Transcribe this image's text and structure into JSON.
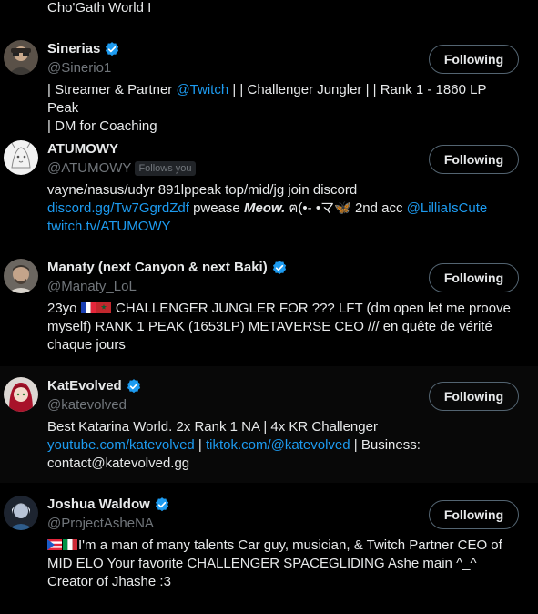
{
  "top_bio_tail": "Cho'Gath World I",
  "follow_button_label": "Following",
  "users": [
    {
      "display_name": "Sinerias",
      "verified": true,
      "handle": "@Sinerio1",
      "bio_line1_a": "| Streamer & Partner ",
      "bio_line1_link": "@Twitch",
      "bio_line1_b": " | | Challenger Jungler | | Rank 1 - 1860 LP Peak",
      "bio_line2": "| DM for Coaching"
    },
    {
      "display_name": "ATUMOWY",
      "verified": false,
      "handle": "@ATUMOWY",
      "follows_you": "Follows you",
      "bio_line1": "vayne/nasus/udyr 891lppeak top/mid/jg join discord",
      "bio_line2_link": "discord.gg/Tw7GgrdZdf",
      "bio_line2_a": " pwease ",
      "bio_line2_meow": "Meow.",
      "bio_line2_kaomoji": " ฅ(•- •マ",
      "bio_line2_butterfly": "🦋",
      "bio_line2_b": " 2nd acc ",
      "bio_line2_link2": "@LilliaIsCute",
      "bio_line3_link": "twitch.tv/ATUMOWY"
    },
    {
      "display_name": "Manaty (next Canyon & next Baki)",
      "verified": true,
      "handle": "@Manaty_LoL",
      "bio_line1_a": "23yo ",
      "bio_line1_b": " CHALLENGER JUNGLER FOR ??? LFT (dm open let me proove",
      "bio_line2": "myself) RANK 1 PEAK (1653LP) METAVERSE CEO /// en quête de vérité",
      "bio_line3": "chaque jours"
    },
    {
      "display_name": "KatEvolved",
      "verified": true,
      "handle": "@katevolved",
      "bio_line1": "Best Katarina World. 2x Rank 1 NA | 4x KR Challenger",
      "bio_line2_link": "youtube.com/katevolved",
      "bio_line2_sep": " | ",
      "bio_line2_link2": "tiktok.com/@katevolved",
      "bio_line2_b": " | Business:",
      "bio_line3": "contact@katevolved.gg"
    },
    {
      "display_name": "Joshua Waldow",
      "verified": true,
      "handle": "@ProjectAsheNA",
      "bio_line1": "I'm a man of many talents Car guy, musician, & Twitch Partner CEO of",
      "bio_line2": "MID ELO Your favorite CHALLENGER SPACEGLIDING Ashe main ^_^",
      "bio_line3": "Creator of Jhashe :3"
    }
  ],
  "colors": {
    "background": "#000000",
    "hover_background": "#080808",
    "text": "#e7e9ea",
    "secondary_text": "#71767b",
    "link": "#1d9bf0",
    "verified": "#1d9bf0",
    "button_border": "#536471"
  }
}
